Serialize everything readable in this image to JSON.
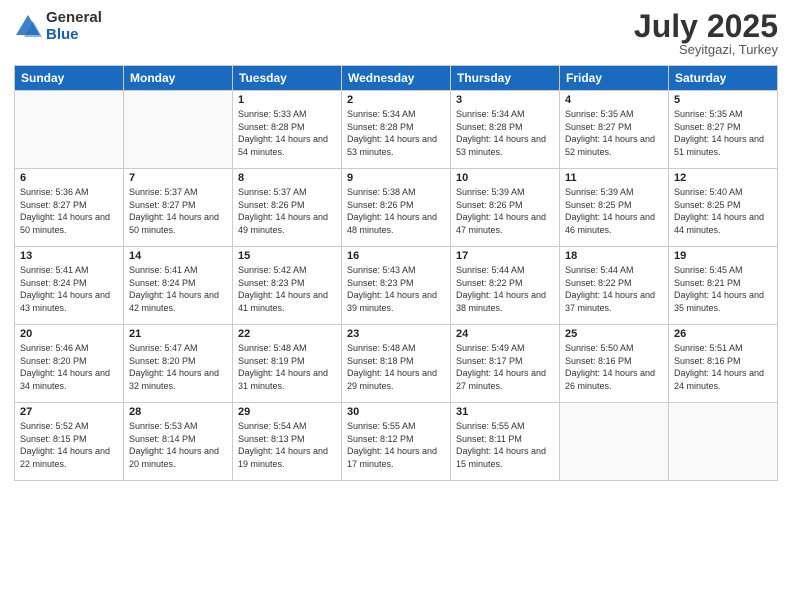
{
  "header": {
    "logo_general": "General",
    "logo_blue": "Blue",
    "month_title": "July 2025",
    "location": "Seyitgazi, Turkey"
  },
  "days_of_week": [
    "Sunday",
    "Monday",
    "Tuesday",
    "Wednesday",
    "Thursday",
    "Friday",
    "Saturday"
  ],
  "weeks": [
    [
      {
        "day": "",
        "info": ""
      },
      {
        "day": "",
        "info": ""
      },
      {
        "day": "1",
        "info": "Sunrise: 5:33 AM\nSunset: 8:28 PM\nDaylight: 14 hours and 54 minutes."
      },
      {
        "day": "2",
        "info": "Sunrise: 5:34 AM\nSunset: 8:28 PM\nDaylight: 14 hours and 53 minutes."
      },
      {
        "day": "3",
        "info": "Sunrise: 5:34 AM\nSunset: 8:28 PM\nDaylight: 14 hours and 53 minutes."
      },
      {
        "day": "4",
        "info": "Sunrise: 5:35 AM\nSunset: 8:27 PM\nDaylight: 14 hours and 52 minutes."
      },
      {
        "day": "5",
        "info": "Sunrise: 5:35 AM\nSunset: 8:27 PM\nDaylight: 14 hours and 51 minutes."
      }
    ],
    [
      {
        "day": "6",
        "info": "Sunrise: 5:36 AM\nSunset: 8:27 PM\nDaylight: 14 hours and 50 minutes."
      },
      {
        "day": "7",
        "info": "Sunrise: 5:37 AM\nSunset: 8:27 PM\nDaylight: 14 hours and 50 minutes."
      },
      {
        "day": "8",
        "info": "Sunrise: 5:37 AM\nSunset: 8:26 PM\nDaylight: 14 hours and 49 minutes."
      },
      {
        "day": "9",
        "info": "Sunrise: 5:38 AM\nSunset: 8:26 PM\nDaylight: 14 hours and 48 minutes."
      },
      {
        "day": "10",
        "info": "Sunrise: 5:39 AM\nSunset: 8:26 PM\nDaylight: 14 hours and 47 minutes."
      },
      {
        "day": "11",
        "info": "Sunrise: 5:39 AM\nSunset: 8:25 PM\nDaylight: 14 hours and 46 minutes."
      },
      {
        "day": "12",
        "info": "Sunrise: 5:40 AM\nSunset: 8:25 PM\nDaylight: 14 hours and 44 minutes."
      }
    ],
    [
      {
        "day": "13",
        "info": "Sunrise: 5:41 AM\nSunset: 8:24 PM\nDaylight: 14 hours and 43 minutes."
      },
      {
        "day": "14",
        "info": "Sunrise: 5:41 AM\nSunset: 8:24 PM\nDaylight: 14 hours and 42 minutes."
      },
      {
        "day": "15",
        "info": "Sunrise: 5:42 AM\nSunset: 8:23 PM\nDaylight: 14 hours and 41 minutes."
      },
      {
        "day": "16",
        "info": "Sunrise: 5:43 AM\nSunset: 8:23 PM\nDaylight: 14 hours and 39 minutes."
      },
      {
        "day": "17",
        "info": "Sunrise: 5:44 AM\nSunset: 8:22 PM\nDaylight: 14 hours and 38 minutes."
      },
      {
        "day": "18",
        "info": "Sunrise: 5:44 AM\nSunset: 8:22 PM\nDaylight: 14 hours and 37 minutes."
      },
      {
        "day": "19",
        "info": "Sunrise: 5:45 AM\nSunset: 8:21 PM\nDaylight: 14 hours and 35 minutes."
      }
    ],
    [
      {
        "day": "20",
        "info": "Sunrise: 5:46 AM\nSunset: 8:20 PM\nDaylight: 14 hours and 34 minutes."
      },
      {
        "day": "21",
        "info": "Sunrise: 5:47 AM\nSunset: 8:20 PM\nDaylight: 14 hours and 32 minutes."
      },
      {
        "day": "22",
        "info": "Sunrise: 5:48 AM\nSunset: 8:19 PM\nDaylight: 14 hours and 31 minutes."
      },
      {
        "day": "23",
        "info": "Sunrise: 5:48 AM\nSunset: 8:18 PM\nDaylight: 14 hours and 29 minutes."
      },
      {
        "day": "24",
        "info": "Sunrise: 5:49 AM\nSunset: 8:17 PM\nDaylight: 14 hours and 27 minutes."
      },
      {
        "day": "25",
        "info": "Sunrise: 5:50 AM\nSunset: 8:16 PM\nDaylight: 14 hours and 26 minutes."
      },
      {
        "day": "26",
        "info": "Sunrise: 5:51 AM\nSunset: 8:16 PM\nDaylight: 14 hours and 24 minutes."
      }
    ],
    [
      {
        "day": "27",
        "info": "Sunrise: 5:52 AM\nSunset: 8:15 PM\nDaylight: 14 hours and 22 minutes."
      },
      {
        "day": "28",
        "info": "Sunrise: 5:53 AM\nSunset: 8:14 PM\nDaylight: 14 hours and 20 minutes."
      },
      {
        "day": "29",
        "info": "Sunrise: 5:54 AM\nSunset: 8:13 PM\nDaylight: 14 hours and 19 minutes."
      },
      {
        "day": "30",
        "info": "Sunrise: 5:55 AM\nSunset: 8:12 PM\nDaylight: 14 hours and 17 minutes."
      },
      {
        "day": "31",
        "info": "Sunrise: 5:55 AM\nSunset: 8:11 PM\nDaylight: 14 hours and 15 minutes."
      },
      {
        "day": "",
        "info": ""
      },
      {
        "day": "",
        "info": ""
      }
    ]
  ]
}
